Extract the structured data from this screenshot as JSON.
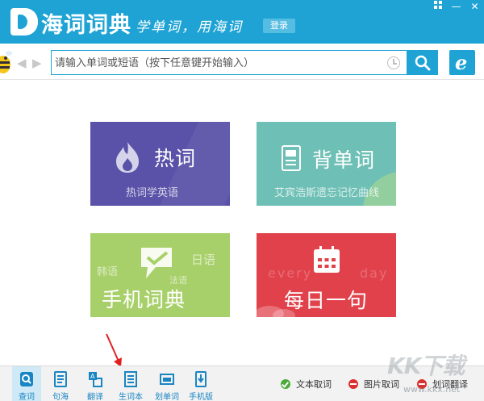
{
  "app": {
    "name": "海词词典",
    "slogan": "学单词，用海词",
    "login_label": "登录",
    "window_controls": [
      "ic",
      "—",
      "✕"
    ]
  },
  "search": {
    "placeholder": "请输入单词或短语（按下任意键开始输入）",
    "value": ""
  },
  "tiles": [
    {
      "title": "热词",
      "subtitle": "热词学英语",
      "color": "#5a52a8",
      "icon": "flame-icon"
    },
    {
      "title": "背单词",
      "subtitle": "艾宾浩斯遗忘记忆曲线",
      "color": "#6ebfb5",
      "icon": "notebook-icon"
    },
    {
      "title": "手机词典",
      "subtitle": "",
      "color": "#a8d06a",
      "icon": "chat-bubble-icon",
      "deco_words": [
        "韩语",
        "日语",
        "法语"
      ]
    },
    {
      "title": "每日一句",
      "subtitle": "",
      "color": "#e1414b",
      "icon": "calendar-icon",
      "deco_words": [
        "every",
        "day"
      ]
    }
  ],
  "bottom_nav": [
    {
      "label": "查词",
      "icon": "search-doc-icon",
      "active": true
    },
    {
      "label": "句海",
      "icon": "sentence-icon",
      "active": false
    },
    {
      "label": "翻译",
      "icon": "translate-icon",
      "active": false
    },
    {
      "label": "生词本",
      "icon": "wordbook-icon",
      "active": false
    },
    {
      "label": "划单词",
      "icon": "highlight-icon",
      "active": false
    },
    {
      "label": "手机版",
      "icon": "mobile-icon",
      "active": false
    }
  ],
  "tools": [
    {
      "label": "文本取词",
      "status": "on"
    },
    {
      "label": "图片取词",
      "status": "off"
    },
    {
      "label": "划词翻译",
      "status": "off"
    }
  ],
  "watermark": {
    "text": "KK下载",
    "url": "www.kkx.net"
  },
  "colors": {
    "brand": "#1ea3d4",
    "nav_text": "#1a85c3",
    "annotation": "#e02020"
  }
}
